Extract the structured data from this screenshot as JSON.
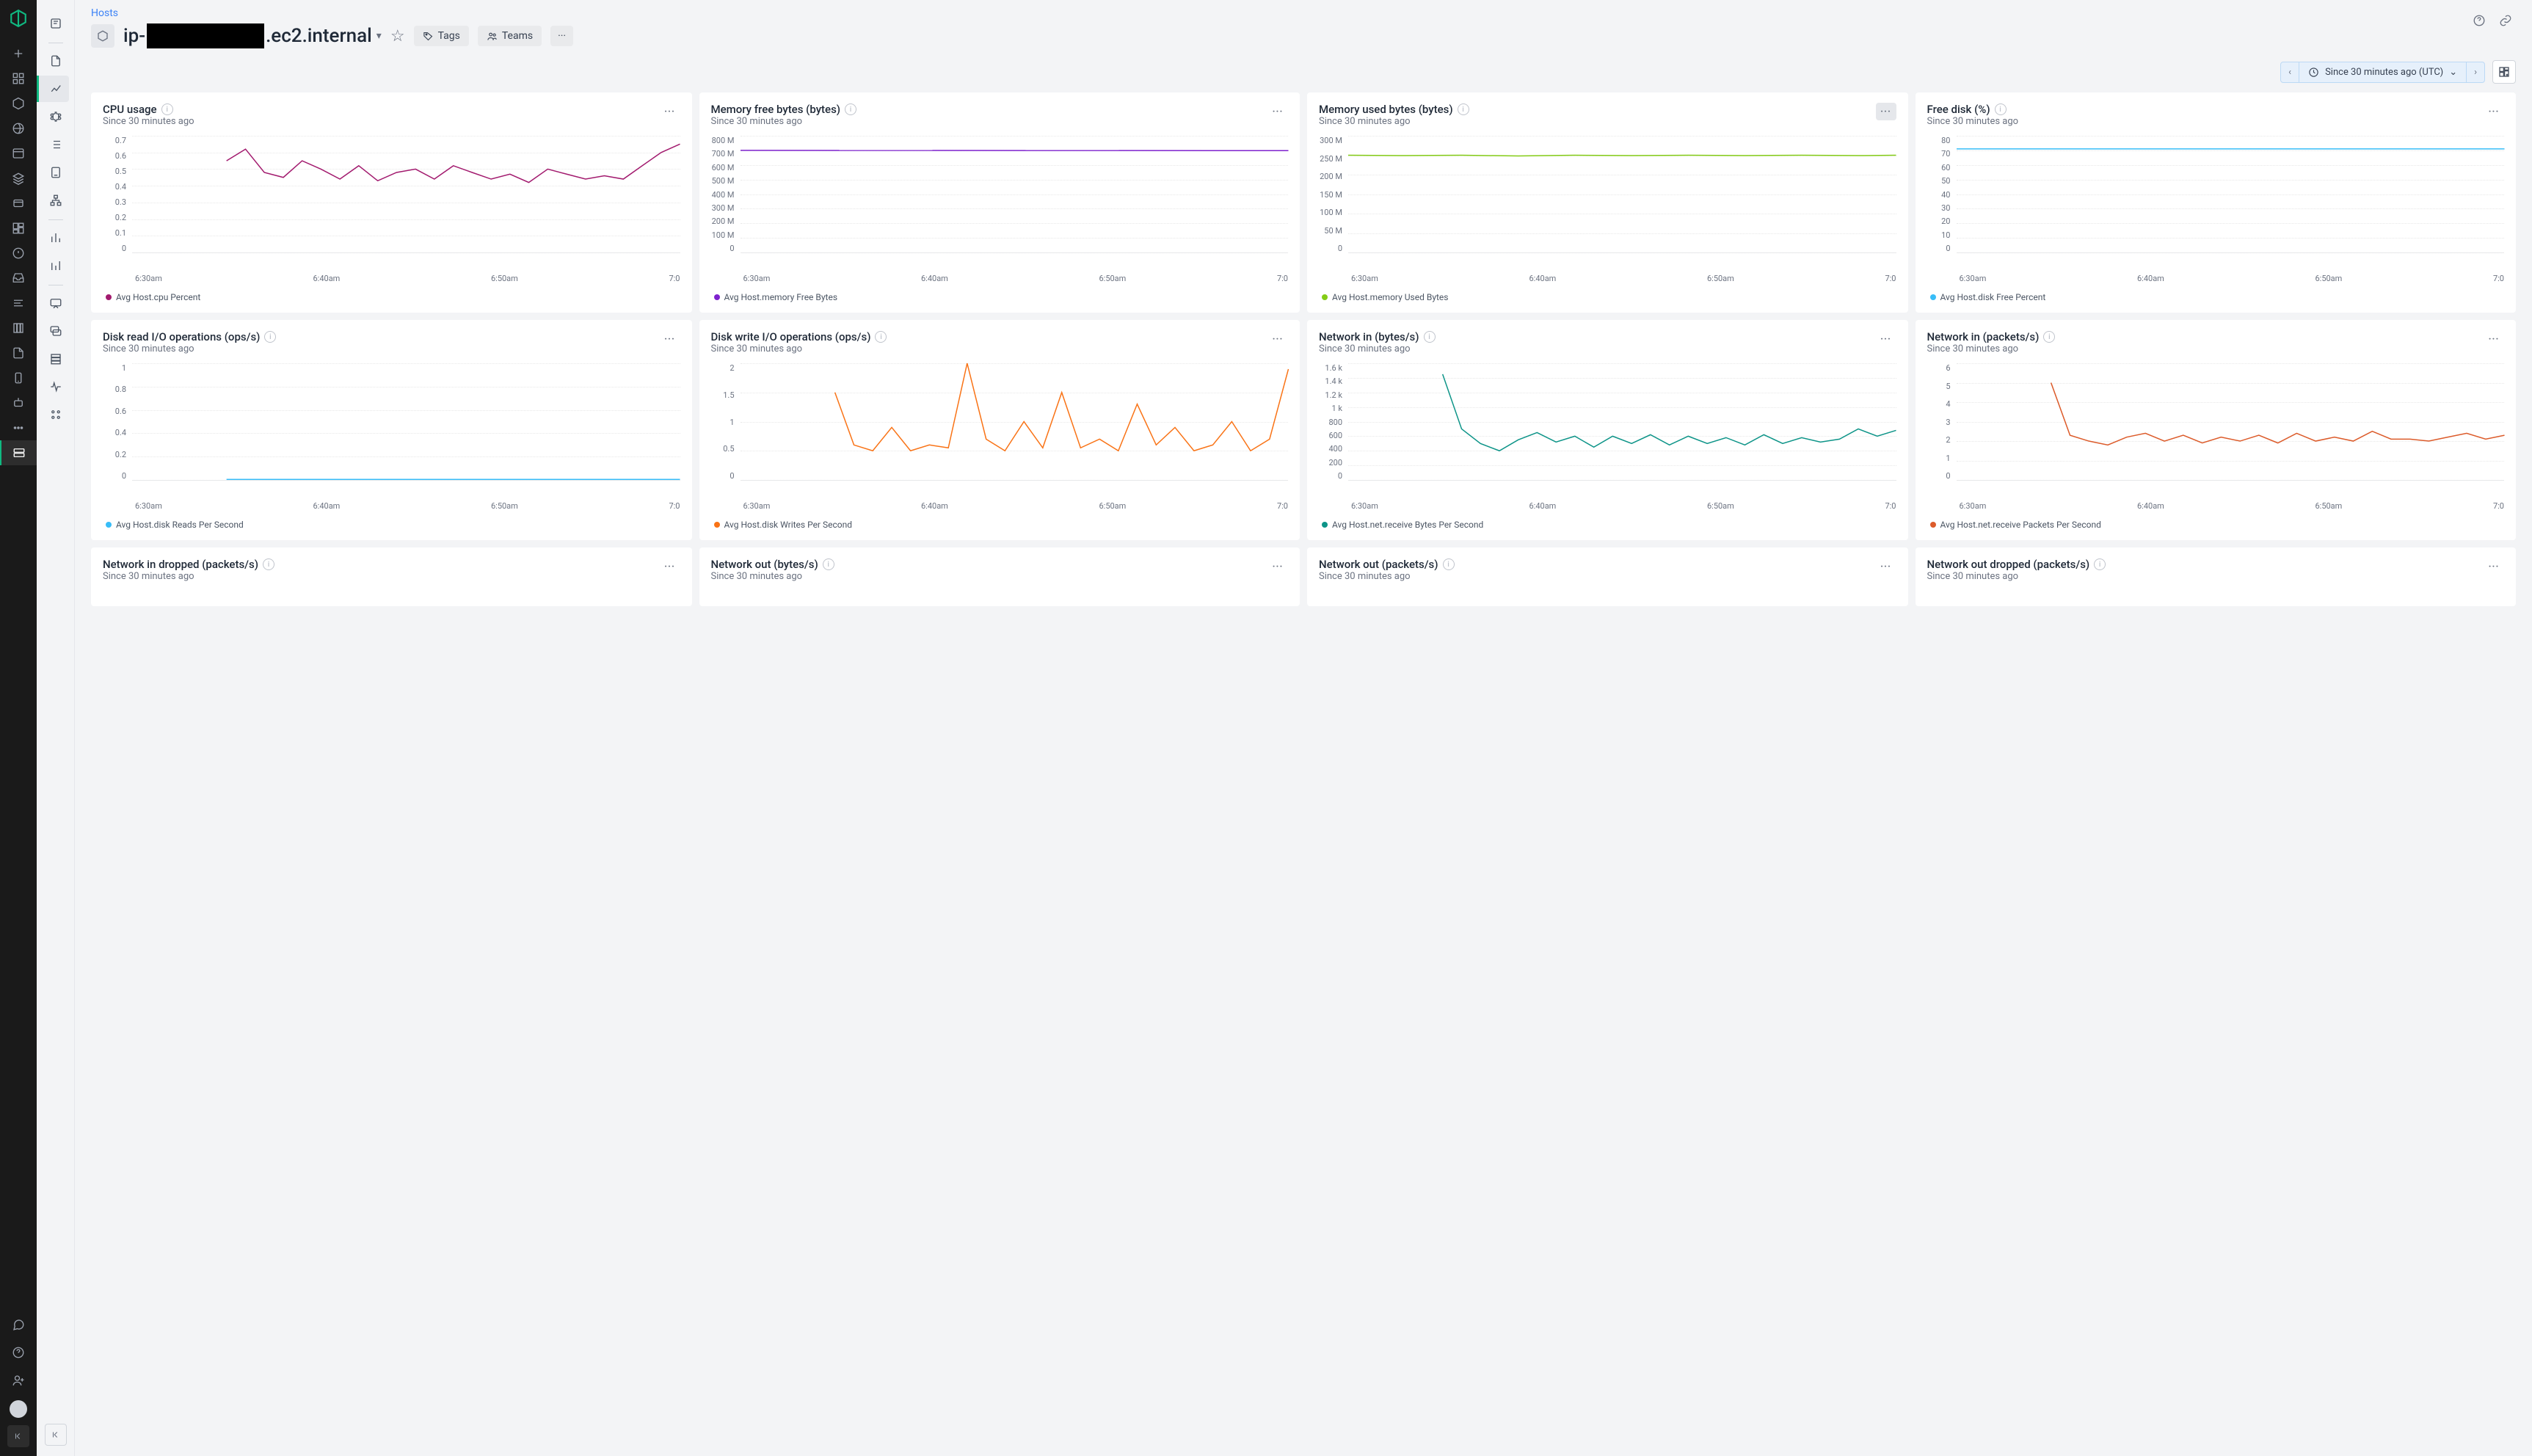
{
  "breadcrumb": "Hosts",
  "host_prefix": "ip-",
  "host_suffix": ".ec2.internal",
  "pills": {
    "tags": "Tags",
    "teams": "Teams"
  },
  "time_picker": {
    "label": "Since 30 minutes ago (UTC)"
  },
  "since_label": "Since 30 minutes ago",
  "x_ticks": [
    "6:30am",
    "6:40am",
    "6:50am",
    "7:0"
  ],
  "cards": [
    {
      "title": "CPU usage",
      "legend": "Avg Host.cpu Percent",
      "color": "#a21a6e",
      "y_ticks": [
        "0.7",
        "0.6",
        "0.5",
        "0.4",
        "0.3",
        "0.2",
        "0.1",
        "0"
      ],
      "chart_data": {
        "type": "line",
        "ylim": [
          0,
          0.7
        ],
        "x": [
          0,
          1,
          2,
          3,
          4,
          5,
          6,
          7,
          8,
          9,
          10,
          11,
          12,
          13,
          14,
          15,
          16,
          17,
          18,
          19,
          20,
          21,
          22,
          23,
          24,
          25,
          26,
          27,
          28,
          29
        ],
        "values": [
          null,
          null,
          null,
          null,
          null,
          0.55,
          0.62,
          0.48,
          0.45,
          0.55,
          0.5,
          0.44,
          0.52,
          0.43,
          0.48,
          0.5,
          0.44,
          0.52,
          0.48,
          0.44,
          0.47,
          0.42,
          0.5,
          0.47,
          0.44,
          0.46,
          0.44,
          0.52,
          0.6,
          0.65
        ]
      }
    },
    {
      "title": "Memory free bytes (bytes)",
      "legend": "Avg Host.memory Free Bytes",
      "color": "#7e22ce",
      "y_ticks": [
        "800 M",
        "700 M",
        "600 M",
        "500 M",
        "400 M",
        "300 M",
        "200 M",
        "100 M",
        "0"
      ],
      "chart_data": {
        "type": "line",
        "ylim": [
          0,
          800
        ],
        "x": [
          0,
          29
        ],
        "values": [
          700,
          698
        ]
      }
    },
    {
      "title": "Memory used bytes (bytes)",
      "legend": "Avg Host.memory Used Bytes",
      "color": "#84cc16",
      "menu_hover": true,
      "y_ticks": [
        "300 M",
        "250 M",
        "200 M",
        "150 M",
        "100 M",
        "50 M",
        "0"
      ],
      "chart_data": {
        "type": "line",
        "ylim": [
          0,
          300
        ],
        "x": [
          0,
          3,
          6,
          9,
          12,
          15,
          18,
          21,
          24,
          27,
          29
        ],
        "values": [
          250,
          249,
          250,
          248,
          250,
          249,
          250,
          249,
          250,
          249,
          250
        ]
      }
    },
    {
      "title": "Free disk (%)",
      "legend": "Avg Host.disk Free Percent",
      "color": "#38bdf8",
      "y_ticks": [
        "80",
        "70",
        "60",
        "50",
        "40",
        "30",
        "20",
        "10",
        "0"
      ],
      "chart_data": {
        "type": "line",
        "ylim": [
          0,
          80
        ],
        "x": [
          0,
          29
        ],
        "values": [
          71,
          71
        ]
      }
    },
    {
      "title": "Disk read I/O operations (ops/s)",
      "legend": "Avg Host.disk Reads Per Second",
      "color": "#38bdf8",
      "y_ticks": [
        "1",
        "0.8",
        "0.6",
        "0.4",
        "0.2",
        "0"
      ],
      "chart_data": {
        "type": "line",
        "ylim": [
          0,
          1
        ],
        "x": [
          0,
          1,
          2,
          3,
          4,
          5,
          6,
          7,
          8,
          9,
          10,
          11,
          12,
          13,
          14,
          15,
          16,
          17,
          18,
          19,
          20,
          21,
          22,
          23,
          24,
          25,
          26,
          27,
          28,
          29
        ],
        "values": [
          null,
          null,
          null,
          null,
          null,
          0.005,
          0.005,
          0.005,
          0.005,
          0.005,
          0.005,
          0.005,
          0.005,
          0.005,
          0.005,
          0.005,
          0.005,
          0.005,
          0.005,
          0.005,
          0.005,
          0.005,
          0.005,
          0.005,
          0.005,
          0.005,
          0.005,
          0.005,
          0.005,
          0.005
        ]
      }
    },
    {
      "title": "Disk write I/O operations (ops/s)",
      "legend": "Avg Host.disk Writes Per Second",
      "color": "#f97316",
      "y_ticks": [
        "2",
        "1.5",
        "1",
        "0.5",
        "0"
      ],
      "chart_data": {
        "type": "line",
        "ylim": [
          0,
          2
        ],
        "x": [
          0,
          1,
          2,
          3,
          4,
          5,
          6,
          7,
          8,
          9,
          10,
          11,
          12,
          13,
          14,
          15,
          16,
          17,
          18,
          19,
          20,
          21,
          22,
          23,
          24,
          25,
          26,
          27,
          28,
          29
        ],
        "values": [
          null,
          null,
          null,
          null,
          null,
          1.5,
          0.6,
          0.5,
          0.9,
          0.5,
          0.6,
          0.55,
          2.0,
          0.7,
          0.5,
          1.0,
          0.55,
          1.5,
          0.55,
          0.7,
          0.5,
          1.3,
          0.6,
          0.9,
          0.5,
          0.6,
          1.0,
          0.5,
          0.7,
          1.9
        ]
      }
    },
    {
      "title": "Network in (bytes/s)",
      "legend": "Avg Host.net.receive Bytes Per Second",
      "color": "#0d9488",
      "y_ticks": [
        "1.6 k",
        "1.4 k",
        "1.2 k",
        "1 k",
        "800",
        "600",
        "400",
        "200",
        "0"
      ],
      "chart_data": {
        "type": "line",
        "ylim": [
          0,
          1600
        ],
        "x": [
          0,
          1,
          2,
          3,
          4,
          5,
          6,
          7,
          8,
          9,
          10,
          11,
          12,
          13,
          14,
          15,
          16,
          17,
          18,
          19,
          20,
          21,
          22,
          23,
          24,
          25,
          26,
          27,
          28,
          29
        ],
        "values": [
          null,
          null,
          null,
          null,
          null,
          1450,
          700,
          500,
          400,
          550,
          650,
          520,
          600,
          450,
          600,
          500,
          620,
          480,
          600,
          500,
          580,
          480,
          620,
          500,
          580,
          520,
          560,
          700,
          600,
          680
        ]
      }
    },
    {
      "title": "Network in (packets/s)",
      "legend": "Avg Host.net.receive Packets Per Second",
      "color": "#dc5b2a",
      "y_ticks": [
        "6",
        "5",
        "4",
        "3",
        "2",
        "1",
        "0"
      ],
      "chart_data": {
        "type": "line",
        "ylim": [
          0,
          6
        ],
        "x": [
          0,
          1,
          2,
          3,
          4,
          5,
          6,
          7,
          8,
          9,
          10,
          11,
          12,
          13,
          14,
          15,
          16,
          17,
          18,
          19,
          20,
          21,
          22,
          23,
          24,
          25,
          26,
          27,
          28,
          29
        ],
        "values": [
          null,
          null,
          null,
          null,
          null,
          5.0,
          2.3,
          2.0,
          1.8,
          2.2,
          2.4,
          2.0,
          2.3,
          1.9,
          2.2,
          2.0,
          2.3,
          1.9,
          2.4,
          2.0,
          2.2,
          2.0,
          2.5,
          2.1,
          2.1,
          2.0,
          2.2,
          2.4,
          2.1,
          2.3
        ]
      }
    },
    {
      "title": "Network in dropped (packets/s)",
      "short": true
    },
    {
      "title": "Network out (bytes/s)",
      "short": true
    },
    {
      "title": "Network out (packets/s)",
      "short": true
    },
    {
      "title": "Network out dropped (packets/s)",
      "short": true
    }
  ]
}
